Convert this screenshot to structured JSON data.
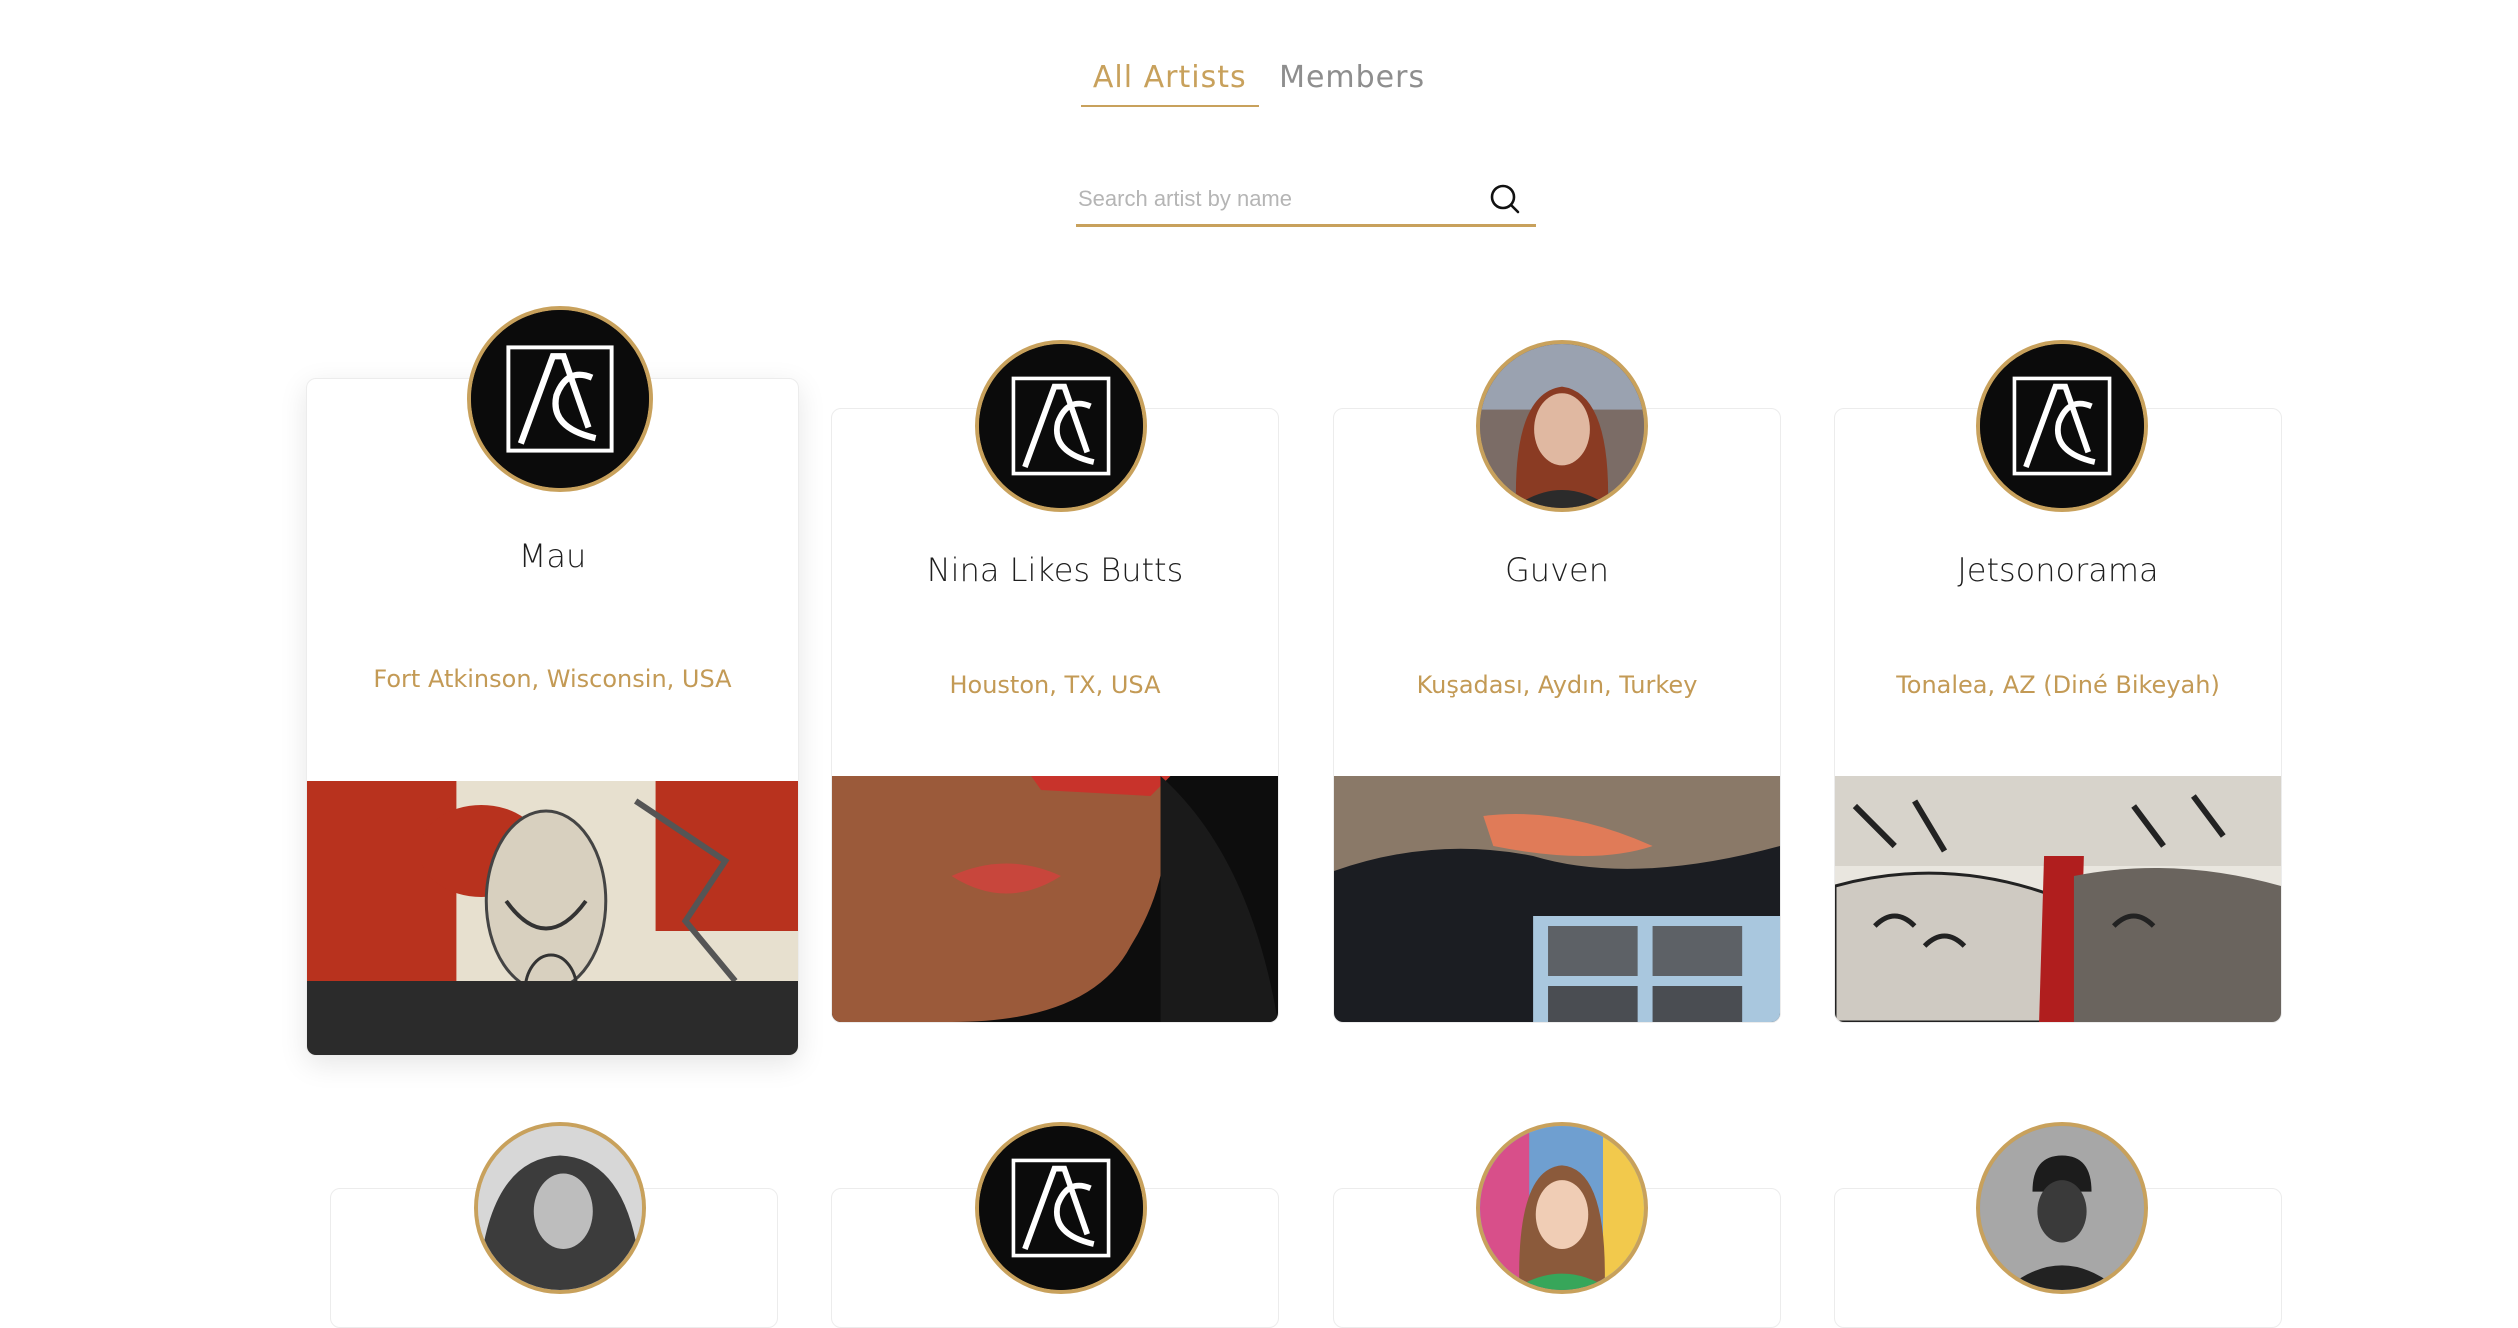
{
  "tabs": [
    {
      "label": "All Artists",
      "active": true
    },
    {
      "label": "Members",
      "active": false
    }
  ],
  "search": {
    "placeholder": "Search artist by name",
    "value": ""
  },
  "artists": [
    {
      "name": "Mau",
      "location": "Fort Atkinson, Wisconsin, USA",
      "avatar": "ac-logo"
    },
    {
      "name": "Nina Likes Butts",
      "location": "Houston, TX, USA",
      "avatar": "ac-logo"
    },
    {
      "name": "Guven",
      "location": "Kuşadası, Aydın, Turkey",
      "avatar": "portrait-photo"
    },
    {
      "name": "Jetsonorama",
      "location": "Tonalea, AZ (Diné Bikeyah)",
      "avatar": "ac-logo"
    }
  ],
  "artists_row2": [
    {
      "avatar": "portrait-photo"
    },
    {
      "avatar": "ac-logo"
    },
    {
      "avatar": "portrait-photo"
    },
    {
      "avatar": "portrait-photo"
    }
  ],
  "colors": {
    "accent": "#c8a15c",
    "location": "#c39a55",
    "inactive_tab": "#8e8e8e"
  }
}
